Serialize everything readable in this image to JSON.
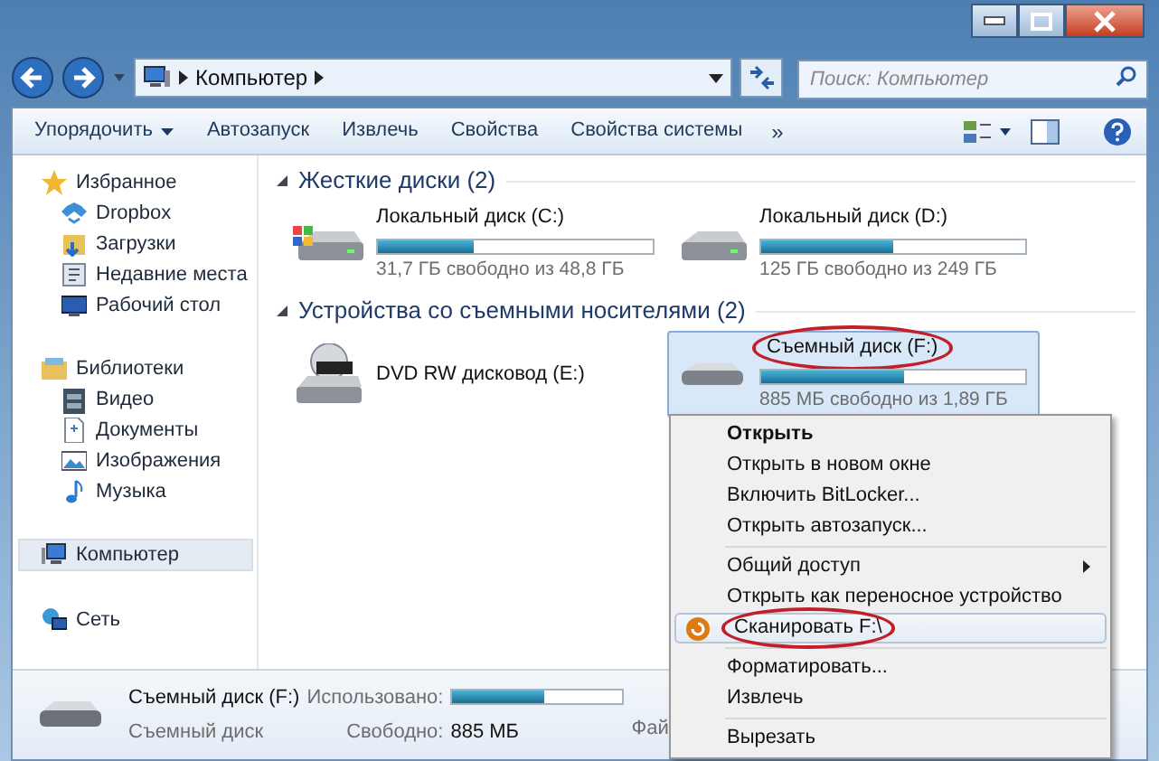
{
  "address_bar": {
    "path": [
      "Компьютер"
    ],
    "search_placeholder": "Поиск: Компьютер"
  },
  "toolbar": {
    "items": [
      {
        "label": "Упорядочить",
        "dropdown": true
      },
      {
        "label": "Автозапуск",
        "dropdown": false
      },
      {
        "label": "Извлечь",
        "dropdown": false
      },
      {
        "label": "Свойства",
        "dropdown": false
      },
      {
        "label": "Свойства системы",
        "dropdown": false
      }
    ],
    "overflow": "»"
  },
  "sidebar": {
    "groups": [
      {
        "label": "Избранное",
        "selected": false,
        "children": [
          {
            "label": "Dropbox",
            "selected": false
          },
          {
            "label": "Загрузки",
            "selected": false
          },
          {
            "label": "Недавние места",
            "selected": false
          },
          {
            "label": "Рабочий стол",
            "selected": false
          }
        ]
      },
      {
        "label": "Библиотеки",
        "selected": false,
        "children": [
          {
            "label": "Видео",
            "selected": false
          },
          {
            "label": "Документы",
            "selected": false
          },
          {
            "label": "Изображения",
            "selected": false
          },
          {
            "label": "Музыка",
            "selected": false
          }
        ]
      },
      {
        "label": "Компьютер",
        "selected": true
      },
      {
        "label": "Сеть",
        "selected": false
      }
    ]
  },
  "sections": [
    {
      "title": "Жесткие диски (2)",
      "drives": [
        {
          "name": "Локальный диск (C:)",
          "kind": "system",
          "level": 0.35,
          "info": "31,7 ГБ свободно из 48,8 ГБ",
          "selected": false,
          "circled": false
        },
        {
          "name": "Локальный диск (D:)",
          "kind": "hdd",
          "level": 0.5,
          "info": "125 ГБ свободно из 249 ГБ",
          "selected": false,
          "circled": false
        }
      ]
    },
    {
      "title": "Устройства со съемными носителями (2)",
      "drives": [
        {
          "name": "DVD RW дисковод (E:)",
          "kind": "dvd",
          "selected": false,
          "circled": false
        },
        {
          "name": "Съемный диск (F:)",
          "kind": "usb",
          "level": 0.54,
          "info": "885 МБ свободно из 1,89 ГБ",
          "selected": true,
          "circled": true
        }
      ]
    }
  ],
  "context_menu": {
    "groups": [
      [
        {
          "label": "Открыть",
          "default": true,
          "selected": false
        },
        {
          "label": "Открыть в новом окне",
          "selected": false
        },
        {
          "label": "Включить BitLocker...",
          "selected": false
        },
        {
          "label": "Открыть автозапуск...",
          "selected": false
        }
      ],
      [
        {
          "label": "Общий доступ",
          "submenu": true,
          "selected": false
        },
        {
          "label": "Открыть как переносное устройство",
          "selected": false
        },
        {
          "label": "Сканировать F:\\",
          "icon": true,
          "circled": true,
          "selected": true
        }
      ],
      [
        {
          "label": "Форматировать...",
          "selected": false
        },
        {
          "label": "Извлечь",
          "selected": false
        }
      ],
      [
        {
          "label": "Вырезать",
          "selected": false
        }
      ]
    ]
  },
  "details": {
    "name": "Съемный диск (F:)",
    "type": "Съемный диск",
    "used_label": "Использовано:",
    "level": 0.54,
    "free_label": "Свободно:",
    "free_value": "885 МБ",
    "column_3": "Фай"
  }
}
